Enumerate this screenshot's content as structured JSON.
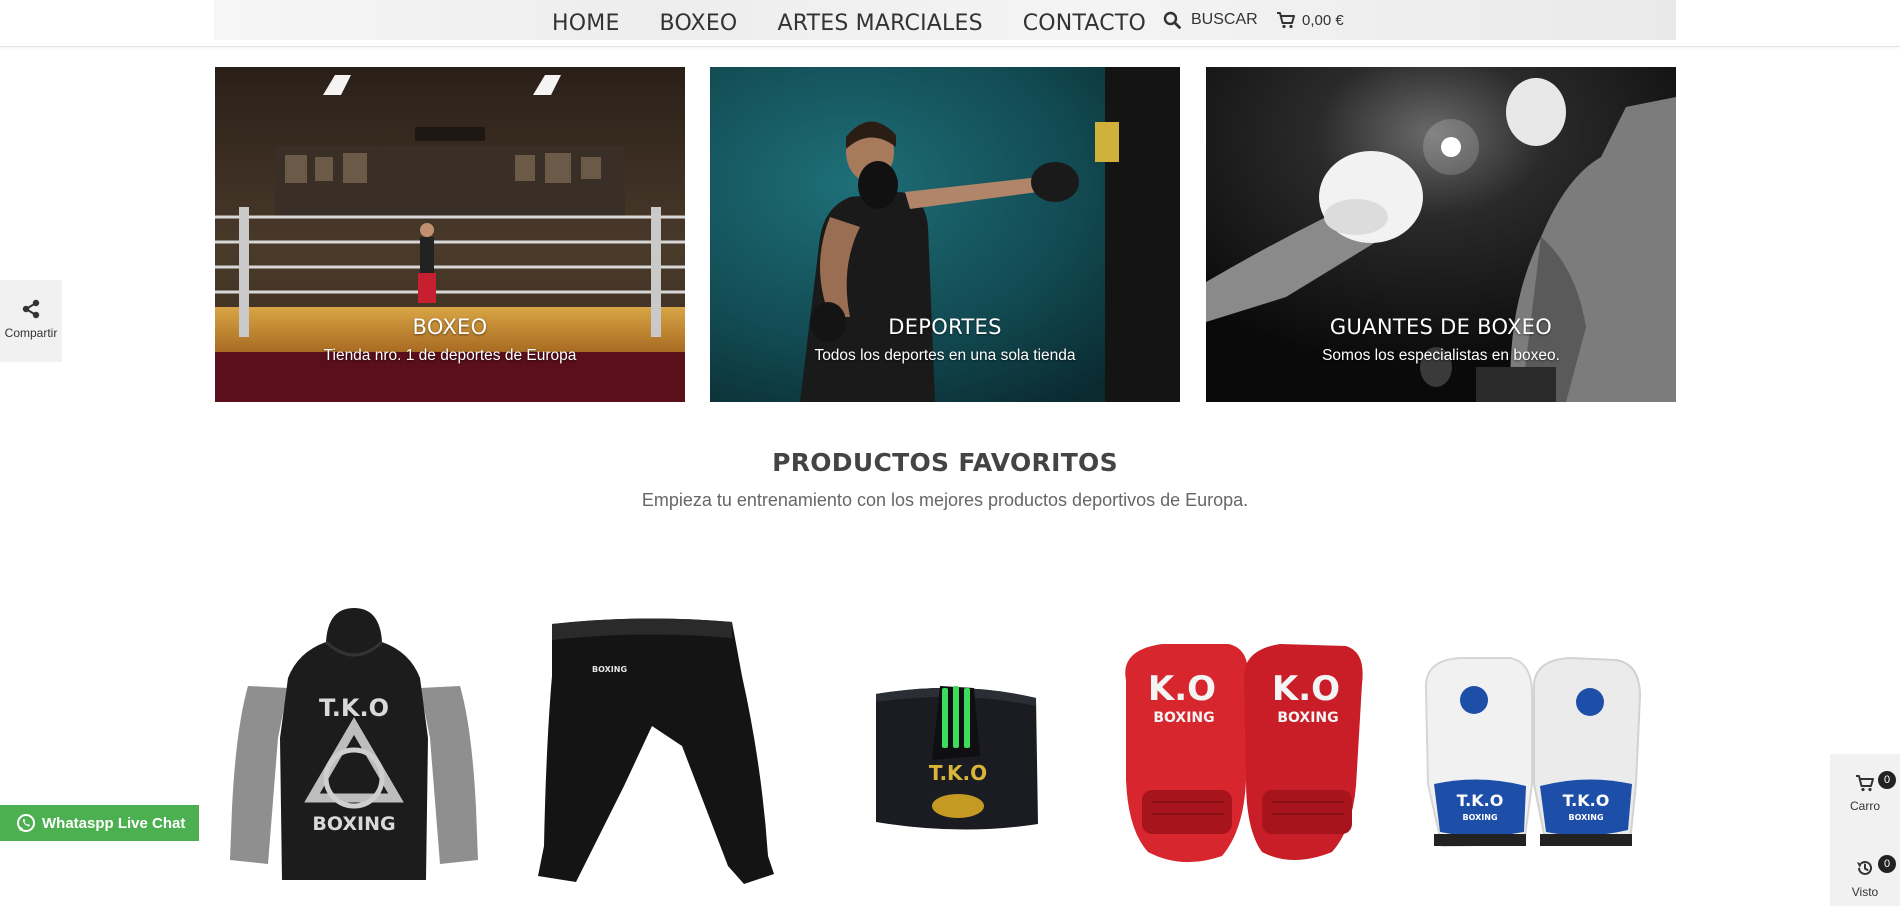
{
  "header": {
    "nav": [
      "HOME",
      "BOXEO",
      "ARTES MARCIALES",
      "CONTACTO"
    ],
    "search_label": "BUSCAR",
    "cart_total": "0,00 €"
  },
  "banners": [
    {
      "title": "BOXEO",
      "subtitle": "Tienda nro. 1 de deportes de Europa"
    },
    {
      "title": "DEPORTES",
      "subtitle": "Todos los deportes en una sola tienda"
    },
    {
      "title": "GUANTES DE BOXEO",
      "subtitle": "Somos los especialistas en boxeo."
    }
  ],
  "section": {
    "title": "PRODUCTOS FAVORITOS",
    "subtitle": "Empieza tu entrenamiento con los mejores productos deportivos de Europa."
  },
  "products": {
    "hoodie_brand": [
      "T.K.O",
      "BOXING"
    ],
    "pants_brand": "BOXING",
    "wrap_brand": "T.K.O",
    "red_gloves_brand": [
      "K.O",
      "BOXING"
    ],
    "white_gloves_brand": [
      "T.K.O",
      "BOXING"
    ]
  },
  "widgets": {
    "share_label": "Compartir",
    "whatsapp_label": "Whataspp Live Chat",
    "cart_label": "Carro",
    "cart_count": "0",
    "viewed_label": "Visto",
    "viewed_count": "0"
  },
  "colors": {
    "whatsapp_green": "#4caf50",
    "glove_red": "#d8262e",
    "glove_blue": "#1e4fa8",
    "wrap_green": "#3ddc5a"
  }
}
